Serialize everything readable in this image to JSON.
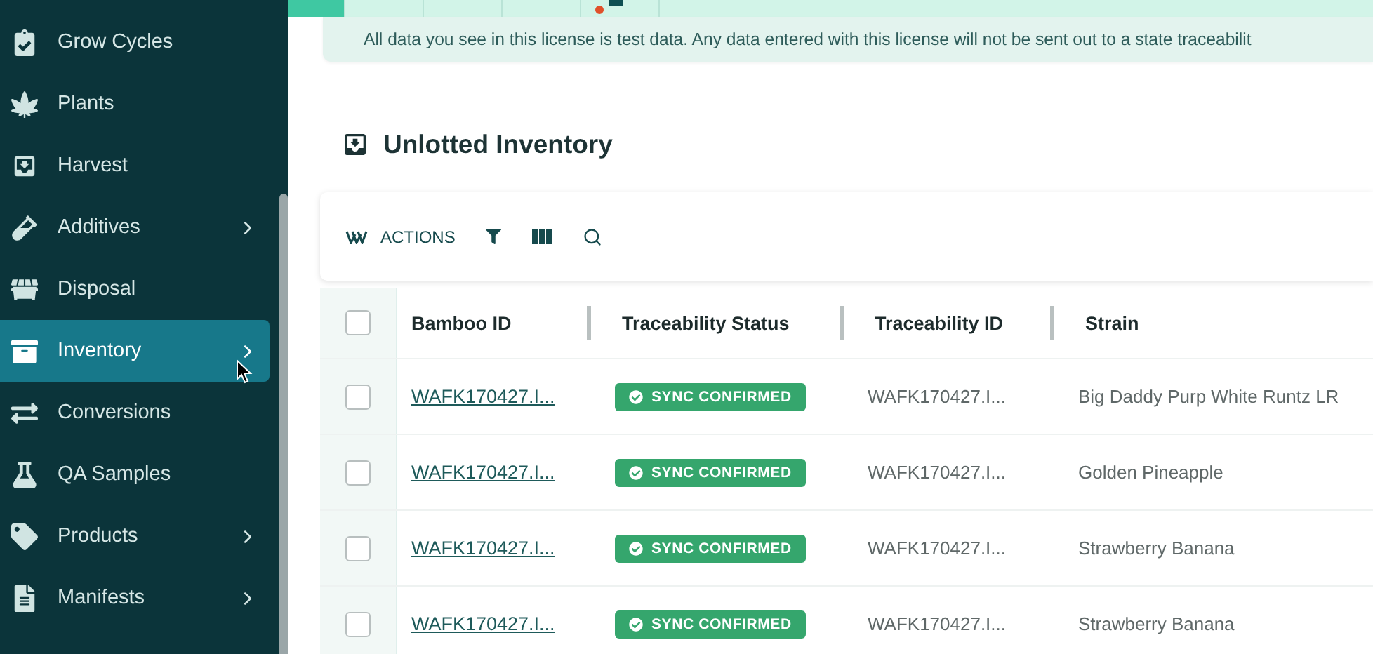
{
  "sidebar": {
    "items": [
      {
        "label": "Grow Cycles",
        "has_submenu": false,
        "selected": false
      },
      {
        "label": "Plants",
        "has_submenu": false,
        "selected": false
      },
      {
        "label": "Harvest",
        "has_submenu": false,
        "selected": false
      },
      {
        "label": "Additives",
        "has_submenu": true,
        "selected": false
      },
      {
        "label": "Disposal",
        "has_submenu": false,
        "selected": false
      },
      {
        "label": "Inventory",
        "has_submenu": true,
        "selected": true
      },
      {
        "label": "Conversions",
        "has_submenu": false,
        "selected": false
      },
      {
        "label": "QA Samples",
        "has_submenu": false,
        "selected": false
      },
      {
        "label": "Products",
        "has_submenu": true,
        "selected": false
      },
      {
        "label": "Manifests",
        "has_submenu": true,
        "selected": false
      }
    ]
  },
  "top_tabs": [
    {
      "selected": true
    },
    {
      "selected": false
    },
    {
      "selected": false
    },
    {
      "selected": false
    },
    {
      "selected": false,
      "notification": true
    }
  ],
  "banner": "All data you see in this license is test data. Any data entered with this license will not be sent out to a state traceabilit",
  "page_title": "Unlotted Inventory",
  "toolbar": {
    "actions_label": "ACTIONS"
  },
  "table": {
    "columns": [
      "Bamboo ID",
      "Traceability Status",
      "Traceability ID",
      "Strain"
    ],
    "all_checked": false,
    "rows": [
      {
        "checked": false,
        "bamboo_id": "WAFK170427.I...",
        "status": "SYNC CONFIRMED",
        "traceability_id": "WAFK170427.I...",
        "strain": "Big Daddy Purp White Runtz LR"
      },
      {
        "checked": false,
        "bamboo_id": "WAFK170427.I...",
        "status": "SYNC CONFIRMED",
        "traceability_id": "WAFK170427.I...",
        "strain": "Golden Pineapple"
      },
      {
        "checked": false,
        "bamboo_id": "WAFK170427.I...",
        "status": "SYNC CONFIRMED",
        "traceability_id": "WAFK170427.I...",
        "strain": "Strawberry Banana"
      },
      {
        "checked": false,
        "bamboo_id": "WAFK170427.I...",
        "status": "SYNC CONFIRMED",
        "traceability_id": "WAFK170427.I...",
        "strain": "Strawberry Banana"
      }
    ]
  }
}
